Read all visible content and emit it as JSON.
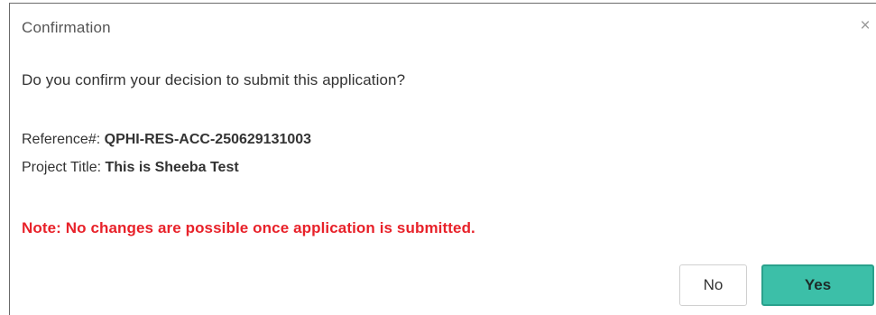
{
  "dialog": {
    "title": "Confirmation",
    "close_glyph": "×",
    "question": "Do you confirm your decision to submit this application?",
    "reference_label": "Reference#:",
    "reference_value": "QPHI-RES-ACC-250629131003",
    "project_label": "Project Title:",
    "project_value": "This is Sheeba Test",
    "note": "Note: No changes are possible once application is submitted.",
    "buttons": {
      "no_label": "No",
      "yes_label": "Yes"
    }
  },
  "colors": {
    "note_red": "#e8222a",
    "yes_teal": "#3cbfa8"
  },
  "icons": {
    "close": "close-icon"
  }
}
